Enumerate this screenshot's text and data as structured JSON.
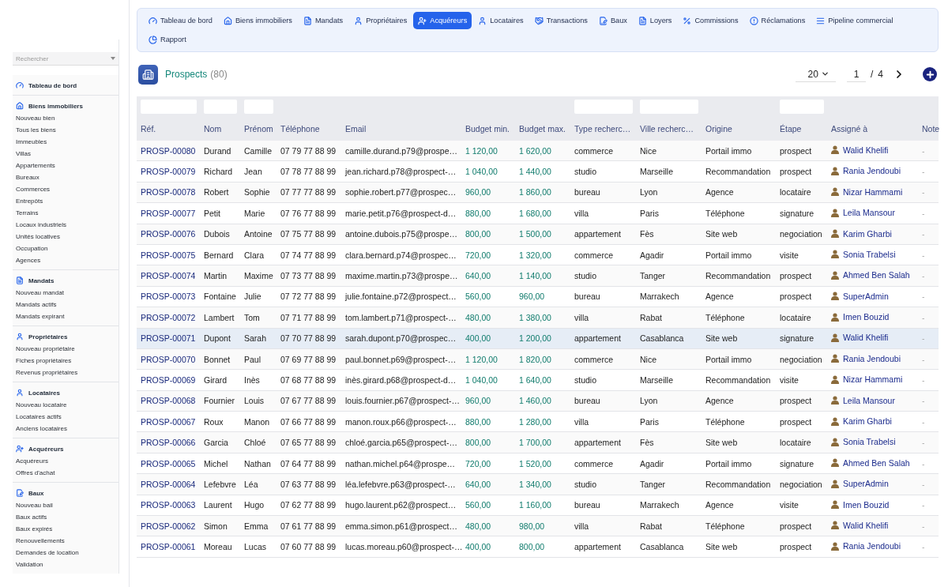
{
  "sidebar": {
    "search": {
      "placeholder": "Rechercher"
    },
    "groups": [
      {
        "title": "Tableau de bord"
      },
      {
        "title": "Biens immobiliers",
        "items": [
          "Nouveau bien",
          "Tous les biens",
          "Immeubles",
          "Villas",
          "Appartements",
          "Bureaux",
          "Commerces",
          "Entrepôts",
          "Terrains",
          "Locaux industriels",
          "Unités locatives",
          "Occupation",
          "Agences"
        ]
      },
      {
        "title": "Mandats",
        "items": [
          "Nouveau mandat",
          "Mandats actifs",
          "Mandats expirant"
        ]
      },
      {
        "title": "Propriétaires",
        "items": [
          "Nouveau propriétaire",
          "Fiches propriétaires",
          "Revenus propriétaires"
        ]
      },
      {
        "title": "Locataires",
        "items": [
          "Nouveau locataire",
          "Locataires actifs",
          "Anciens locataires"
        ]
      },
      {
        "title": "Acquéreurs",
        "items": [
          "Acquéreurs",
          "Offres d'achat"
        ]
      },
      {
        "title": "Baux",
        "items": [
          "Nouveau bail",
          "Baux actifs",
          "Baux expirés",
          "Renouvellements",
          "Demandes de location",
          "Validation"
        ]
      }
    ]
  },
  "tabs": [
    {
      "label": "Tableau de bord",
      "selected": false
    },
    {
      "label": "Biens immobiliers",
      "selected": false
    },
    {
      "label": "Mandats",
      "selected": false
    },
    {
      "label": "Propriétaires",
      "selected": false
    },
    {
      "label": "Acquéreurs",
      "selected": true
    },
    {
      "label": "Locataires",
      "selected": false
    },
    {
      "label": "Transactions",
      "selected": false
    },
    {
      "label": "Baux",
      "selected": false
    },
    {
      "label": "Loyers",
      "selected": false
    },
    {
      "label": "Commissions",
      "selected": false
    },
    {
      "label": "Réclamations",
      "selected": false
    },
    {
      "label": "Pipeline commercial",
      "selected": false
    },
    {
      "label": "Rapport",
      "selected": false
    }
  ],
  "header": {
    "title": "Prospects",
    "count": "(80)",
    "page_size": "20",
    "page": "1",
    "separator": "/",
    "total_pages": "4"
  },
  "table": {
    "columns": [
      {
        "label": "Réf.",
        "filter": true
      },
      {
        "label": "Nom",
        "filter": true
      },
      {
        "label": "Prénom",
        "filter": true
      },
      {
        "label": "Téléphone",
        "filter": false
      },
      {
        "label": "Email",
        "filter": false
      },
      {
        "label": "Budget min.",
        "filter": false
      },
      {
        "label": "Budget max.",
        "filter": false
      },
      {
        "label": "Type recherc…",
        "filter": true
      },
      {
        "label": "Ville recherc…",
        "filter": true
      },
      {
        "label": "Origine",
        "filter": false
      },
      {
        "label": "Étape",
        "filter": true
      },
      {
        "label": "Assigné à",
        "filter": false
      },
      {
        "label": "Note",
        "filter": false
      }
    ],
    "rows": [
      {
        "cells": [
          "PROSP-00080",
          "Durand",
          "Camille",
          "07 79 77 88 99",
          "camille.durand.p79@prospe…",
          "1 120,00",
          "1 620,00",
          "commerce",
          "Nice",
          "Portail immo",
          "prospect",
          "Walid Khelifi",
          "-"
        ],
        "selected": false
      },
      {
        "cells": [
          "PROSP-00079",
          "Richard",
          "Jean",
          "07 78 77 88 99",
          "jean.richard.p78@prospect-…",
          "1 040,00",
          "1 440,00",
          "studio",
          "Marseille",
          "Recommandation",
          "prospect",
          "Rania Jendoubi",
          "-"
        ],
        "selected": false
      },
      {
        "cells": [
          "PROSP-00078",
          "Robert",
          "Sophie",
          "07 77 77 88 99",
          "sophie.robert.p77@prospec…",
          "960,00",
          "1 860,00",
          "bureau",
          "Lyon",
          "Agence",
          "locataire",
          "Nizar Hammami",
          "-"
        ],
        "selected": false
      },
      {
        "cells": [
          "PROSP-00077",
          "Petit",
          "Marie",
          "07 76 77 88 99",
          "marie.petit.p76@prospect-d…",
          "880,00",
          "1 680,00",
          "villa",
          "Paris",
          "Téléphone",
          "signature",
          "Leila Mansour",
          "-"
        ],
        "selected": false
      },
      {
        "cells": [
          "PROSP-00076",
          "Dubois",
          "Antoine",
          "07 75 77 88 99",
          "antoine.dubois.p75@prospe…",
          "800,00",
          "1 500,00",
          "appartement",
          "Fès",
          "Site web",
          "negociation",
          "Karim Gharbi",
          "-"
        ],
        "selected": false
      },
      {
        "cells": [
          "PROSP-00075",
          "Bernard",
          "Clara",
          "07 74 77 88 99",
          "clara.bernard.p74@prospec…",
          "720,00",
          "1 320,00",
          "commerce",
          "Agadir",
          "Portail immo",
          "visite",
          "Sonia Trabelsi",
          "-"
        ],
        "selected": false
      },
      {
        "cells": [
          "PROSP-00074",
          "Martin",
          "Maxime",
          "07 73 77 88 99",
          "maxime.martin.p73@prospe…",
          "640,00",
          "1 140,00",
          "studio",
          "Tanger",
          "Recommandation",
          "prospect",
          "Ahmed Ben Salah",
          "-"
        ],
        "selected": false
      },
      {
        "cells": [
          "PROSP-00073",
          "Fontaine",
          "Julie",
          "07 72 77 88 99",
          "julie.fontaine.p72@prospect…",
          "560,00",
          "960,00",
          "bureau",
          "Marrakech",
          "Agence",
          "prospect",
          "SuperAdmin",
          "-"
        ],
        "selected": false
      },
      {
        "cells": [
          "PROSP-00072",
          "Lambert",
          "Tom",
          "07 71 77 88 99",
          "tom.lambert.p71@prospect-…",
          "480,00",
          "1 380,00",
          "villa",
          "Rabat",
          "Téléphone",
          "locataire",
          "Imen Bouzid",
          "-"
        ],
        "selected": false
      },
      {
        "cells": [
          "PROSP-00071",
          "Dupont",
          "Sarah",
          "07 70 77 88 99",
          "sarah.dupont.p70@prospec…",
          "400,00",
          "1 200,00",
          "appartement",
          "Casablanca",
          "Site web",
          "signature",
          "Walid Khelifi",
          "-"
        ],
        "selected": true
      },
      {
        "cells": [
          "PROSP-00070",
          "Bonnet",
          "Paul",
          "07 69 77 88 99",
          "paul.bonnet.p69@prospect-…",
          "1 120,00",
          "1 820,00",
          "commerce",
          "Nice",
          "Portail immo",
          "negociation",
          "Rania Jendoubi",
          "-"
        ],
        "selected": false
      },
      {
        "cells": [
          "PROSP-00069",
          "Girard",
          "Inès",
          "07 68 77 88 99",
          "inès.girard.p68@prospect-d…",
          "1 040,00",
          "1 640,00",
          "studio",
          "Marseille",
          "Recommandation",
          "visite",
          "Nizar Hammami",
          "-"
        ],
        "selected": false
      },
      {
        "cells": [
          "PROSP-00068",
          "Fournier",
          "Louis",
          "07 67 77 88 99",
          "louis.fournier.p67@prospect-…",
          "960,00",
          "1 460,00",
          "bureau",
          "Lyon",
          "Agence",
          "prospect",
          "Leila Mansour",
          "-"
        ],
        "selected": false
      },
      {
        "cells": [
          "PROSP-00067",
          "Roux",
          "Manon",
          "07 66 77 88 99",
          "manon.roux.p66@prospect-…",
          "880,00",
          "1 280,00",
          "villa",
          "Paris",
          "Téléphone",
          "prospect",
          "Karim Gharbi",
          "-"
        ],
        "selected": false
      },
      {
        "cells": [
          "PROSP-00066",
          "Garcia",
          "Chloé",
          "07 65 77 88 99",
          "chloé.garcia.p65@prospect-…",
          "800,00",
          "1 700,00",
          "appartement",
          "Fès",
          "Site web",
          "locataire",
          "Sonia Trabelsi",
          "-"
        ],
        "selected": false
      },
      {
        "cells": [
          "PROSP-00065",
          "Michel",
          "Nathan",
          "07 64 77 88 99",
          "nathan.michel.p64@prospe…",
          "720,00",
          "1 520,00",
          "commerce",
          "Agadir",
          "Portail immo",
          "signature",
          "Ahmed Ben Salah",
          "-"
        ],
        "selected": false
      },
      {
        "cells": [
          "PROSP-00064",
          "Lefebvre",
          "Léa",
          "07 63 77 88 99",
          "léa.lefebvre.p63@prospect-…",
          "640,00",
          "1 340,00",
          "studio",
          "Tanger",
          "Recommandation",
          "negociation",
          "SuperAdmin",
          "-"
        ],
        "selected": false
      },
      {
        "cells": [
          "PROSP-00063",
          "Laurent",
          "Hugo",
          "07 62 77 88 99",
          "hugo.laurent.p62@prospect…",
          "560,00",
          "1 160,00",
          "bureau",
          "Marrakech",
          "Agence",
          "visite",
          "Imen Bouzid",
          "-"
        ],
        "selected": false
      },
      {
        "cells": [
          "PROSP-00062",
          "Simon",
          "Emma",
          "07 61 77 88 99",
          "emma.simon.p61@prospect…",
          "480,00",
          "980,00",
          "villa",
          "Rabat",
          "Téléphone",
          "prospect",
          "Walid Khelifi",
          "-"
        ],
        "selected": false
      },
      {
        "cells": [
          "PROSP-00061",
          "Moreau",
          "Lucas",
          "07 60 77 88 99",
          "lucas.moreau.p60@prospect-…",
          "400,00",
          "800,00",
          "appartement",
          "Casablanca",
          "Site web",
          "prospect",
          "Rania Jendoubi",
          "-"
        ],
        "selected": false
      }
    ]
  }
}
